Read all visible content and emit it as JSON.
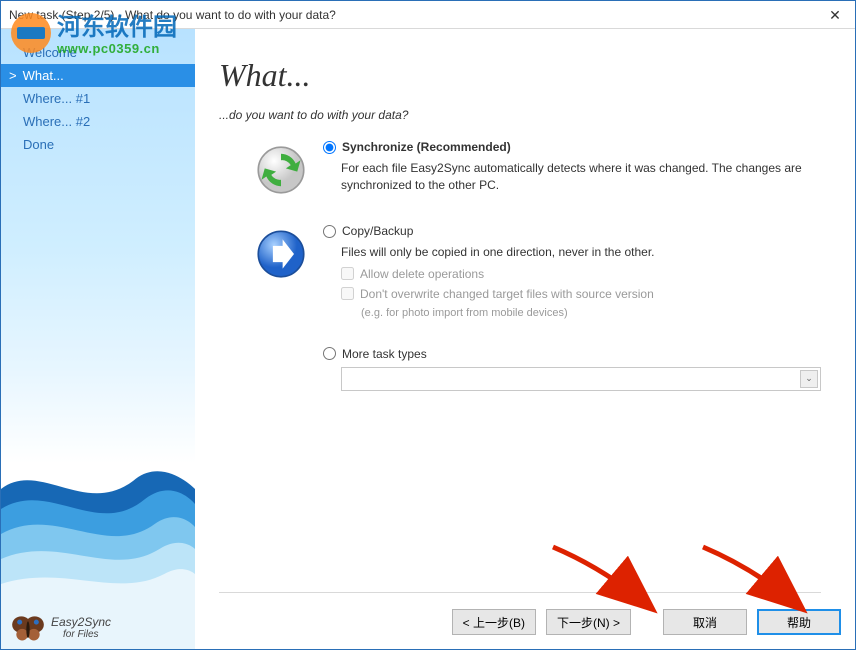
{
  "window": {
    "title": "New task (Step 2/5) - What do you want to do with your data?"
  },
  "sidebar": {
    "items": [
      {
        "label": "Welcome"
      },
      {
        "label": "What..."
      },
      {
        "label": "Where... #1"
      },
      {
        "label": "Where... #2"
      },
      {
        "label": "Done"
      }
    ],
    "logo": {
      "line1": "Easy2Sync",
      "line2": "for Files"
    }
  },
  "main": {
    "heading": "What...",
    "subhead": "...do you want to do with your data?",
    "options": {
      "sync": {
        "label": "Synchronize (Recommended)",
        "desc": "For each file Easy2Sync automatically detects where it was changed. The changes are synchronized to the other PC."
      },
      "copy": {
        "label": "Copy/Backup",
        "desc": "Files will only be copied in one direction, never in the other.",
        "allow_delete": "Allow delete operations",
        "dont_overwrite": "Don't overwrite changed target files with source version",
        "dont_overwrite_hint": "(e.g. for photo import from mobile devices)"
      },
      "more": {
        "label": "More task types"
      }
    }
  },
  "buttons": {
    "back": "< 上一步(B)",
    "next": "下一步(N) >",
    "cancel": "取消",
    "help": "帮助"
  },
  "watermark": {
    "site": "河东软件园",
    "url": "www.pc0359.cn"
  }
}
